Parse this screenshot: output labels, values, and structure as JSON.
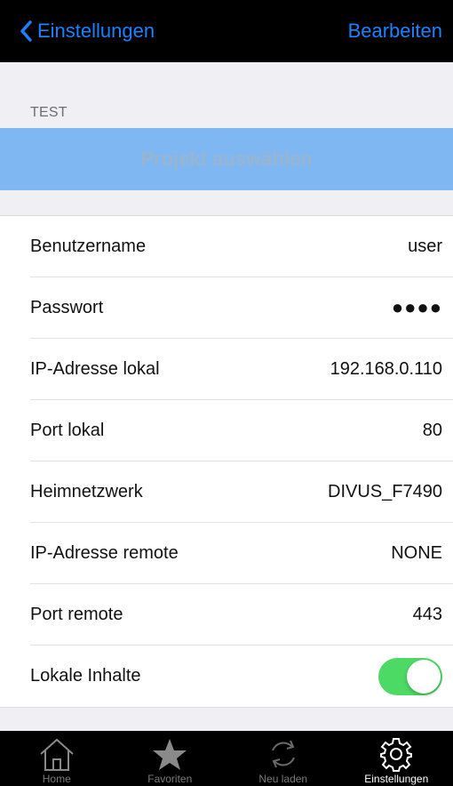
{
  "navbar": {
    "back_label": "Einstellungen",
    "edit_label": "Bearbeiten",
    "accent_color": "#1a82ff"
  },
  "section": {
    "header": "TEST",
    "project_button_label": "Projekt auswählen"
  },
  "settings": [
    {
      "label": "Benutzername",
      "value": "user"
    },
    {
      "label": "Passwort",
      "value": "●●●●"
    },
    {
      "label": "IP-Adresse lokal",
      "value": "192.168.0.110"
    },
    {
      "label": "Port lokal",
      "value": "80"
    },
    {
      "label": "Heimnetzwerk",
      "value": "DIVUS_F7490"
    },
    {
      "label": "IP-Adresse remote",
      "value": "NONE"
    },
    {
      "label": "Port remote",
      "value": "443"
    }
  ],
  "local_content": {
    "label": "Lokale Inhalte",
    "enabled": true,
    "toggle_color": "#4cd964"
  },
  "tabbar": {
    "tabs": [
      {
        "label": "Home",
        "icon": "home-icon"
      },
      {
        "label": "Favoriten",
        "icon": "star-icon"
      },
      {
        "label": "Neu laden",
        "icon": "refresh-icon"
      },
      {
        "label": "Einstellungen",
        "icon": "gear-icon",
        "active": true
      }
    ]
  }
}
